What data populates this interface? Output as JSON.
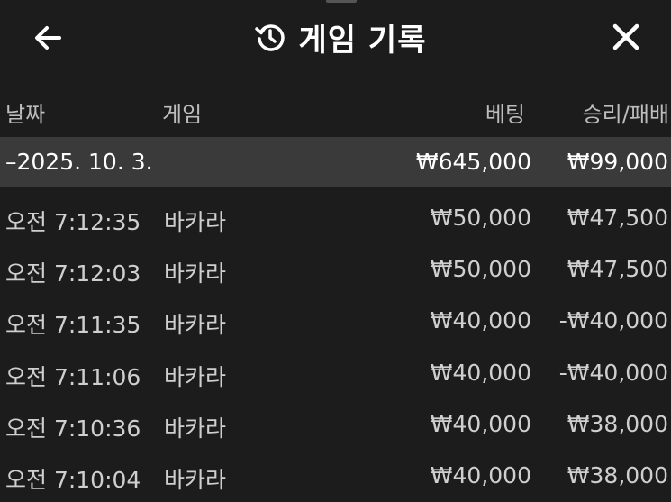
{
  "header": {
    "title": "게임 기록",
    "back_icon": "arrow-left-icon",
    "history_icon": "history-clock-icon",
    "close_icon": "close-x-icon"
  },
  "columns": {
    "date": "날짜",
    "game": "게임",
    "bet": "베팅",
    "result": "승리/패배"
  },
  "summary": {
    "date": "–2025. 10. 3.",
    "bet": "₩645,000",
    "result": "₩99,000"
  },
  "rows": [
    {
      "time": "오전 7:12:35",
      "game": "바카라",
      "bet": "₩50,000",
      "result": "₩47,500"
    },
    {
      "time": "오전 7:12:03",
      "game": "바카라",
      "bet": "₩50,000",
      "result": "₩47,500"
    },
    {
      "time": "오전 7:11:35",
      "game": "바카라",
      "bet": "₩40,000",
      "result": "-₩40,000"
    },
    {
      "time": "오전 7:11:06",
      "game": "바카라",
      "bet": "₩40,000",
      "result": "-₩40,000"
    },
    {
      "time": "오전 7:10:36",
      "game": "바카라",
      "bet": "₩40,000",
      "result": "₩38,000"
    },
    {
      "time": "오전 7:10:04",
      "game": "바카라",
      "bet": "₩40,000",
      "result": "₩38,000"
    }
  ],
  "colors": {
    "background": "#1c1c1c",
    "summary_background": "#3a3a3a",
    "text_primary": "#ffffff",
    "text_secondary": "#cfcfcf"
  }
}
